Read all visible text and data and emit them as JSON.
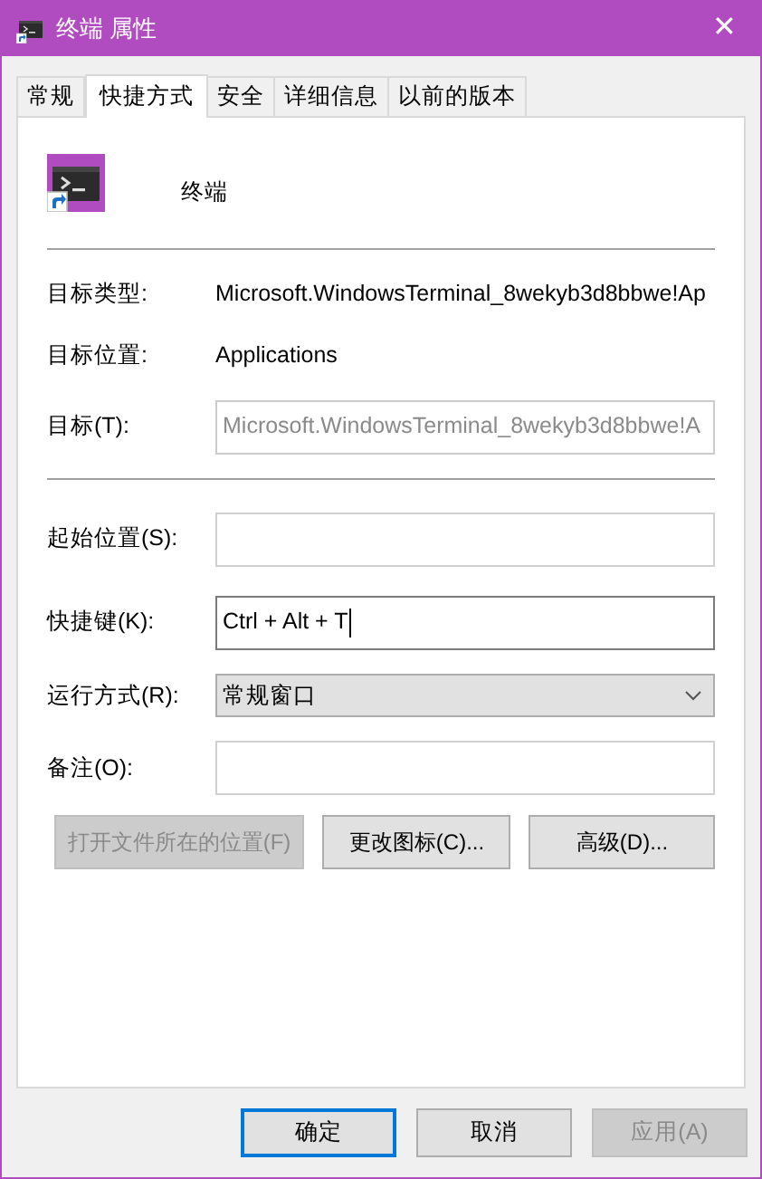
{
  "window": {
    "title": "终端 属性",
    "close": "✕"
  },
  "tabs": [
    {
      "label": "常规",
      "selected": false
    },
    {
      "label": "快捷方式",
      "selected": true
    },
    {
      "label": "安全",
      "selected": false
    },
    {
      "label": "详细信息",
      "selected": false
    },
    {
      "label": "以前的版本",
      "selected": false
    }
  ],
  "shortcut": {
    "name": "终端"
  },
  "info_rows": [
    {
      "kind": "text",
      "label": "目标类型:",
      "value": "Microsoft.WindowsTerminal_8wekyb3d8bbwe!Ap"
    },
    {
      "kind": "text",
      "label": "目标位置:",
      "value": "Applications"
    },
    {
      "kind": "field",
      "label": "目标(T):",
      "value": "Microsoft.WindowsTerminal_8wekyb3d8bbwe!A",
      "disabled": true
    }
  ],
  "fields": [
    {
      "kind": "input",
      "label": "起始位置(S):",
      "focused": false
    },
    {
      "kind": "input",
      "label": "快捷键(K):",
      "value": "Ctrl + Alt + T",
      "focused": true
    },
    {
      "kind": "select",
      "label": "运行方式(R):",
      "value": "常规窗口"
    },
    {
      "kind": "input",
      "label": "备注(O):",
      "focused": false
    }
  ],
  "actions": [
    {
      "label": "打开文件所在的位置(F)",
      "disabled": true
    },
    {
      "label": "更改图标(C)...",
      "disabled": false
    },
    {
      "label": "高级(D)...",
      "disabled": false
    }
  ],
  "buttons": [
    {
      "label": "确定",
      "default": true,
      "disabled": false
    },
    {
      "label": "取消",
      "default": false,
      "disabled": false
    },
    {
      "label": "应用(A)",
      "default": false,
      "disabled": true
    }
  ]
}
